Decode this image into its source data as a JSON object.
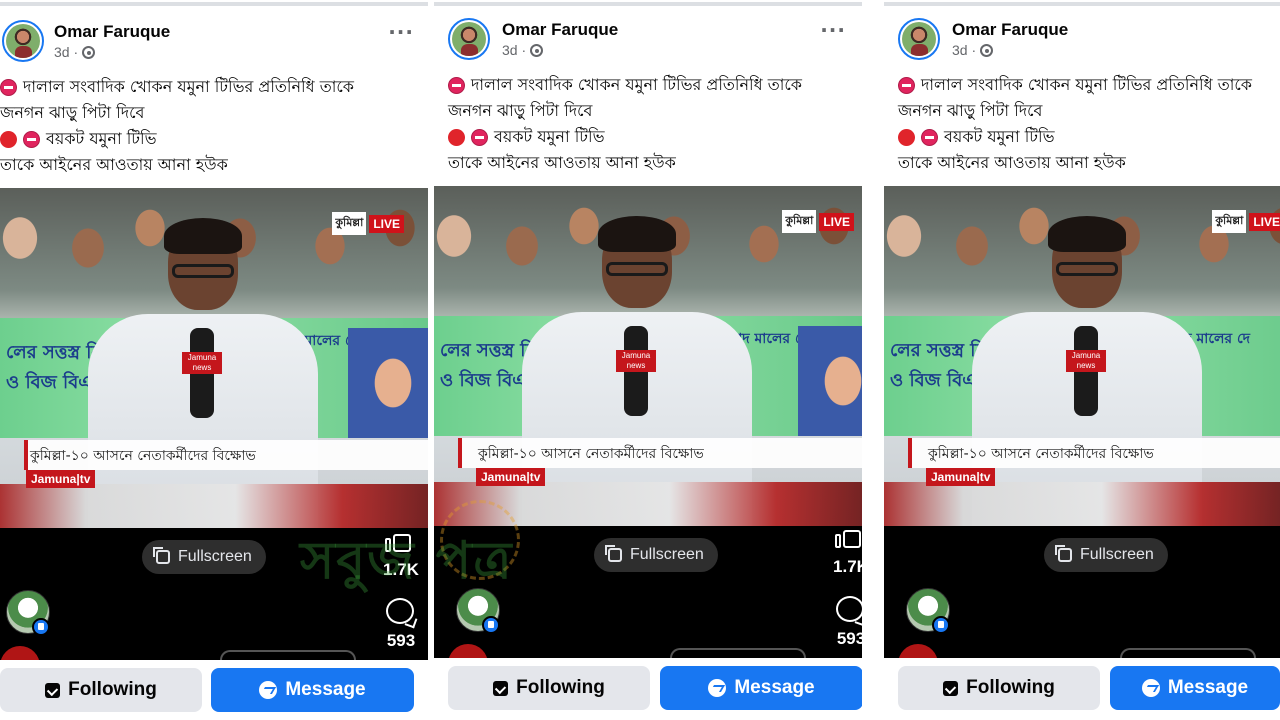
{
  "post": {
    "author": "Omar Faruque",
    "time": "3d ·",
    "more_label": "···",
    "caption": {
      "line1": "দালাল সংবাদিক খোকন যমুনা টিভির প্রতিনিধি তাকে",
      "line2": "জনগন ঝাড়ু পিটা দিবে",
      "line3": "বয়কট যমুনা টিভি",
      "line4": "তাকে আইনের আওতায় আনা হউক"
    }
  },
  "video": {
    "live_place": "কুমিল্লা",
    "live_tag": "LIVE",
    "mic_flag": "Jamuna news",
    "banner_left": "লের সত্তস্ত্র নির্বা তাকারী ও বিজ বিএনপি'র স",
    "banner_right": "জিন্দাবাদ মালের দে",
    "lower_third": "কুমিল্লা-১০ আসনে নেতাকর্মীদের বিক্ষোভ",
    "channel_logo": "Jamuna|tv",
    "fullscreen_label": "Fullscreen"
  },
  "reactions": {
    "likes": "1.7K",
    "comments": "593"
  },
  "actions": {
    "following_label": "Following",
    "message_label": "Message"
  },
  "watermark": "সবুজ পত্র",
  "colors": {
    "facebook_blue": "#1877f2",
    "button_gray": "#e4e6eb",
    "jamuna_red": "#c4161c"
  },
  "panels": [
    1,
    2,
    3
  ]
}
